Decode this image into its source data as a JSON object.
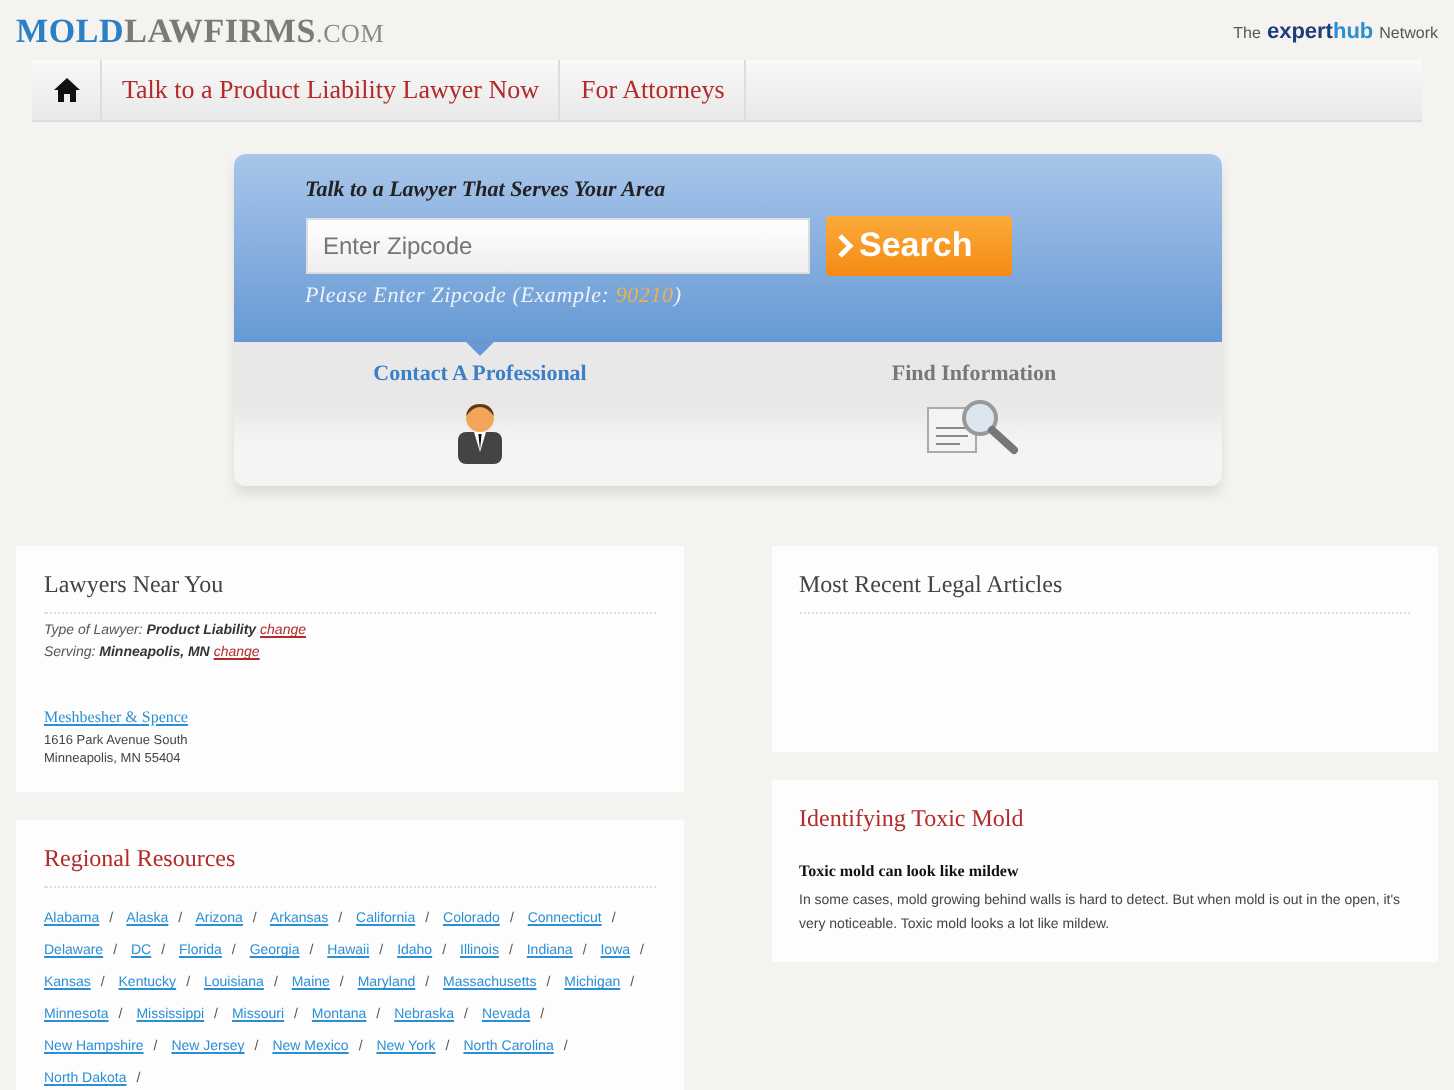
{
  "header": {
    "logo": {
      "primary": "MOLD",
      "secondary": "LAWFIRMS",
      "suffix": ".COM"
    },
    "network": {
      "prefix": "The",
      "brand_a": "expert",
      "brand_b": "hub",
      "suffix": "Network"
    }
  },
  "nav": {
    "items": [
      {
        "label": "Talk to a Product Liability Lawyer Now"
      },
      {
        "label": "For Attorneys"
      }
    ]
  },
  "search_panel": {
    "title": "Talk to a Lawyer That Serves Your Area",
    "zip_field": {
      "placeholder": "Enter Zipcode"
    },
    "button": "Search",
    "hint_prefix": "Please Enter Zipcode (Example: ",
    "hint_example": "90210",
    "hint_suffix": ")",
    "tabs": [
      {
        "label": "Contact A Professional",
        "selected": true,
        "kind": "person"
      },
      {
        "label": "Find Information",
        "selected": false,
        "kind": "info"
      }
    ]
  },
  "lawyers_near_you": {
    "title": "Lawyers Near You",
    "filters": [
      {
        "label": "Type of Lawyer:",
        "value": "Product Liability",
        "link": "change"
      },
      {
        "label": "Serving:",
        "value": "Minneapolis, MN",
        "link": "change"
      }
    ],
    "lawyer": {
      "name": "Meshbesher & Spence",
      "address_lines": [
        "1616 Park Avenue South",
        "Minneapolis, MN 55404"
      ]
    }
  },
  "regional_resources": {
    "title": "Regional Resources",
    "states": [
      "Alabama",
      "Alaska",
      "Arizona",
      "Arkansas",
      "California",
      "Colorado",
      "Connecticut",
      "Delaware",
      "DC",
      "Florida",
      "Georgia",
      "Hawaii",
      "Idaho",
      "Illinois",
      "Indiana",
      "Iowa",
      "Kansas",
      "Kentucky",
      "Louisiana",
      "Maine",
      "Maryland",
      "Massachusetts",
      "Michigan",
      "Minnesota",
      "Mississippi",
      "Missouri",
      "Montana",
      "Nebraska",
      "Nevada",
      "New Hampshire",
      "New Jersey",
      "New Mexico",
      "New York",
      "North Carolina",
      "North Dakota"
    ],
    "separator": "/"
  },
  "recent_articles": {
    "title": "Most Recent Legal Articles"
  },
  "article": {
    "title": "Identifying Toxic Mold",
    "subtitle": "Toxic mold can look like mildew",
    "body": "In some cases, mold growing behind walls is hard to detect. But when mold is out in the open, it's very noticeable. Toxic mold looks a lot like mildew."
  }
}
